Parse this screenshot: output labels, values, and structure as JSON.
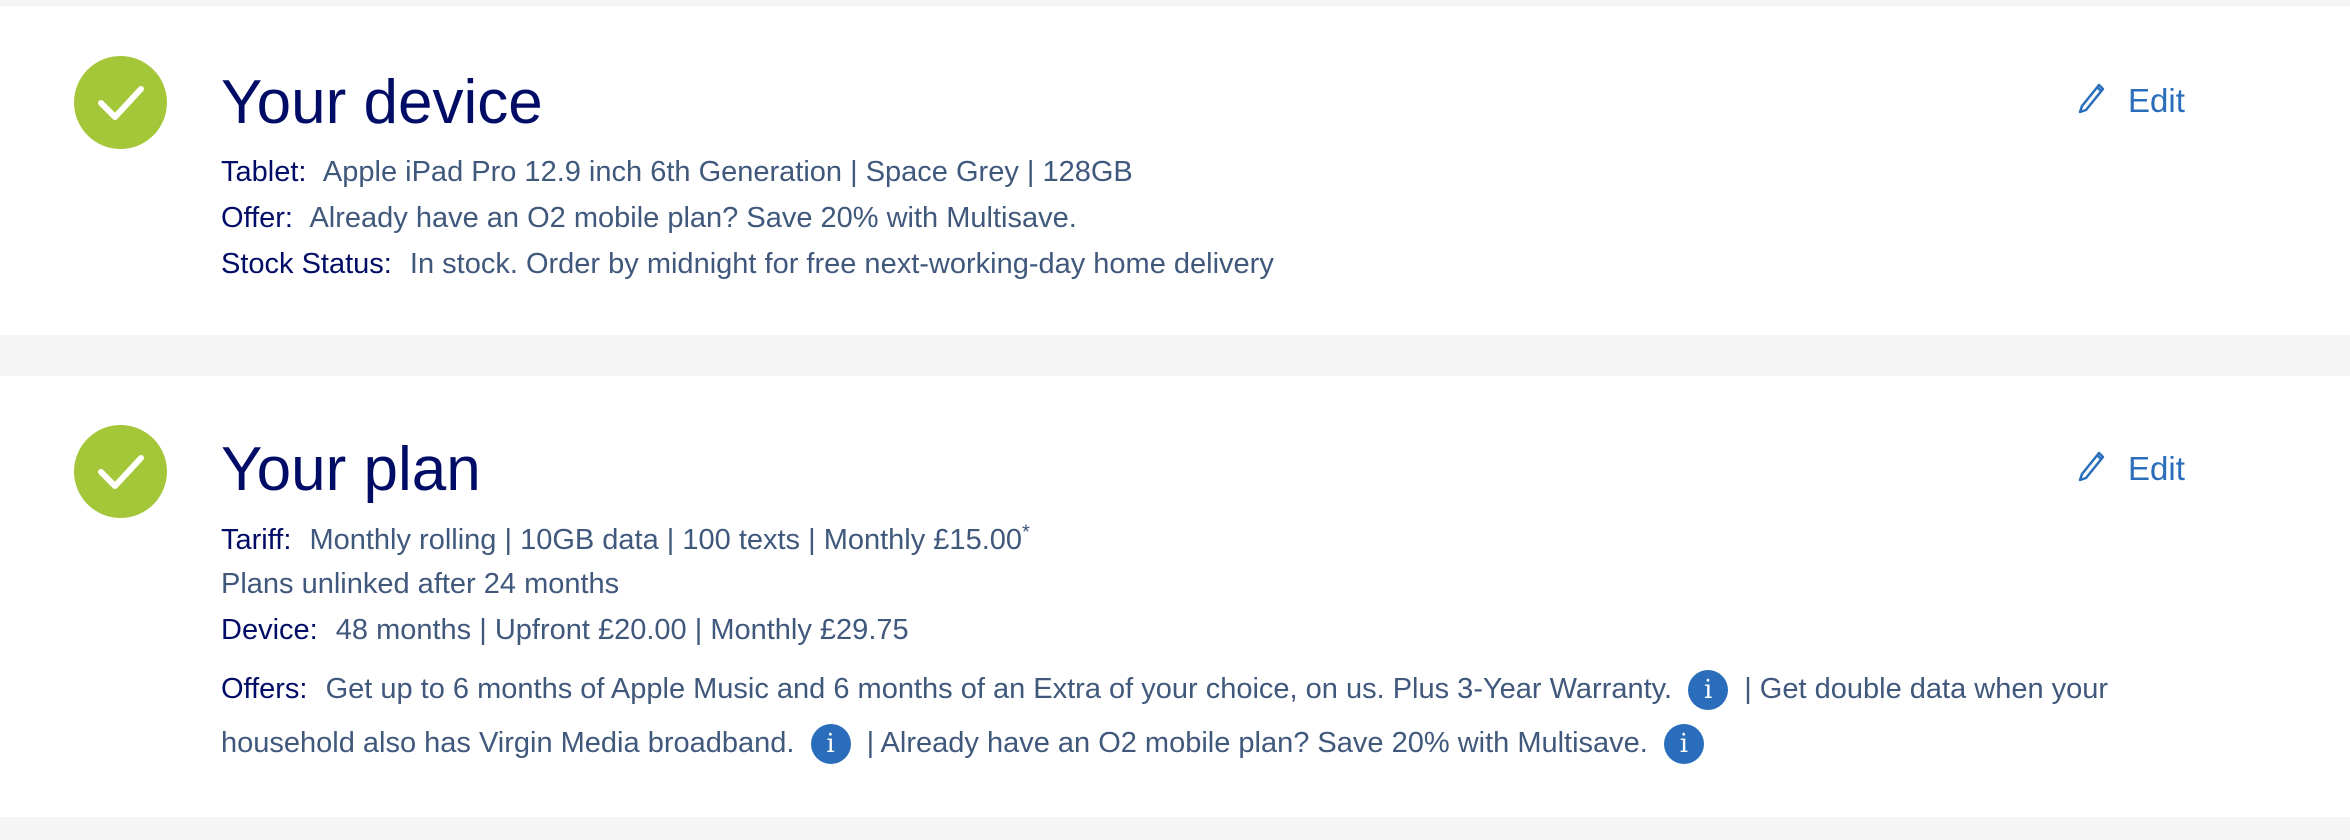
{
  "device_section": {
    "title": "Your device",
    "edit_label": "Edit",
    "rows": [
      {
        "label": "Tablet:",
        "value": "Apple iPad Pro 12.9 inch 6th Generation | Space Grey | 128GB"
      },
      {
        "label": "Offer:",
        "value": "Already have an O2 mobile plan? Save 20% with Multisave."
      },
      {
        "label": "Stock Status:",
        "value": "In stock. Order by midnight for free next-working-day home delivery"
      }
    ]
  },
  "plan_section": {
    "title": "Your plan",
    "edit_label": "Edit",
    "tariff": {
      "label": "Tariff:",
      "value": "Monthly rolling | 10GB data | 100 texts | Monthly £15.00",
      "footnote": "*"
    },
    "unlinked_note": "Plans unlinked after 24 months",
    "device": {
      "label": "Device:",
      "value": "48 months | Upfront £20.00 | Monthly £29.75"
    },
    "offers": {
      "label": "Offers:",
      "part1": "Get up to 6 months of Apple Music and 6 months of an Extra of your choice, on us. Plus 3-Year Warranty.",
      "part2": "| Get double data when your household also has Virgin Media broadband.",
      "part3": "| Already have an O2 mobile plan? Save 20% with Multisave."
    }
  },
  "icons": {
    "check": "check-circle-icon",
    "edit": "pencil-icon",
    "info": "info-icon",
    "info_glyph": "i"
  },
  "colors": {
    "check_green": "#a4c639",
    "title_navy": "#000c66",
    "text_slate": "#40587c",
    "link_blue": "#2a6ebb"
  }
}
